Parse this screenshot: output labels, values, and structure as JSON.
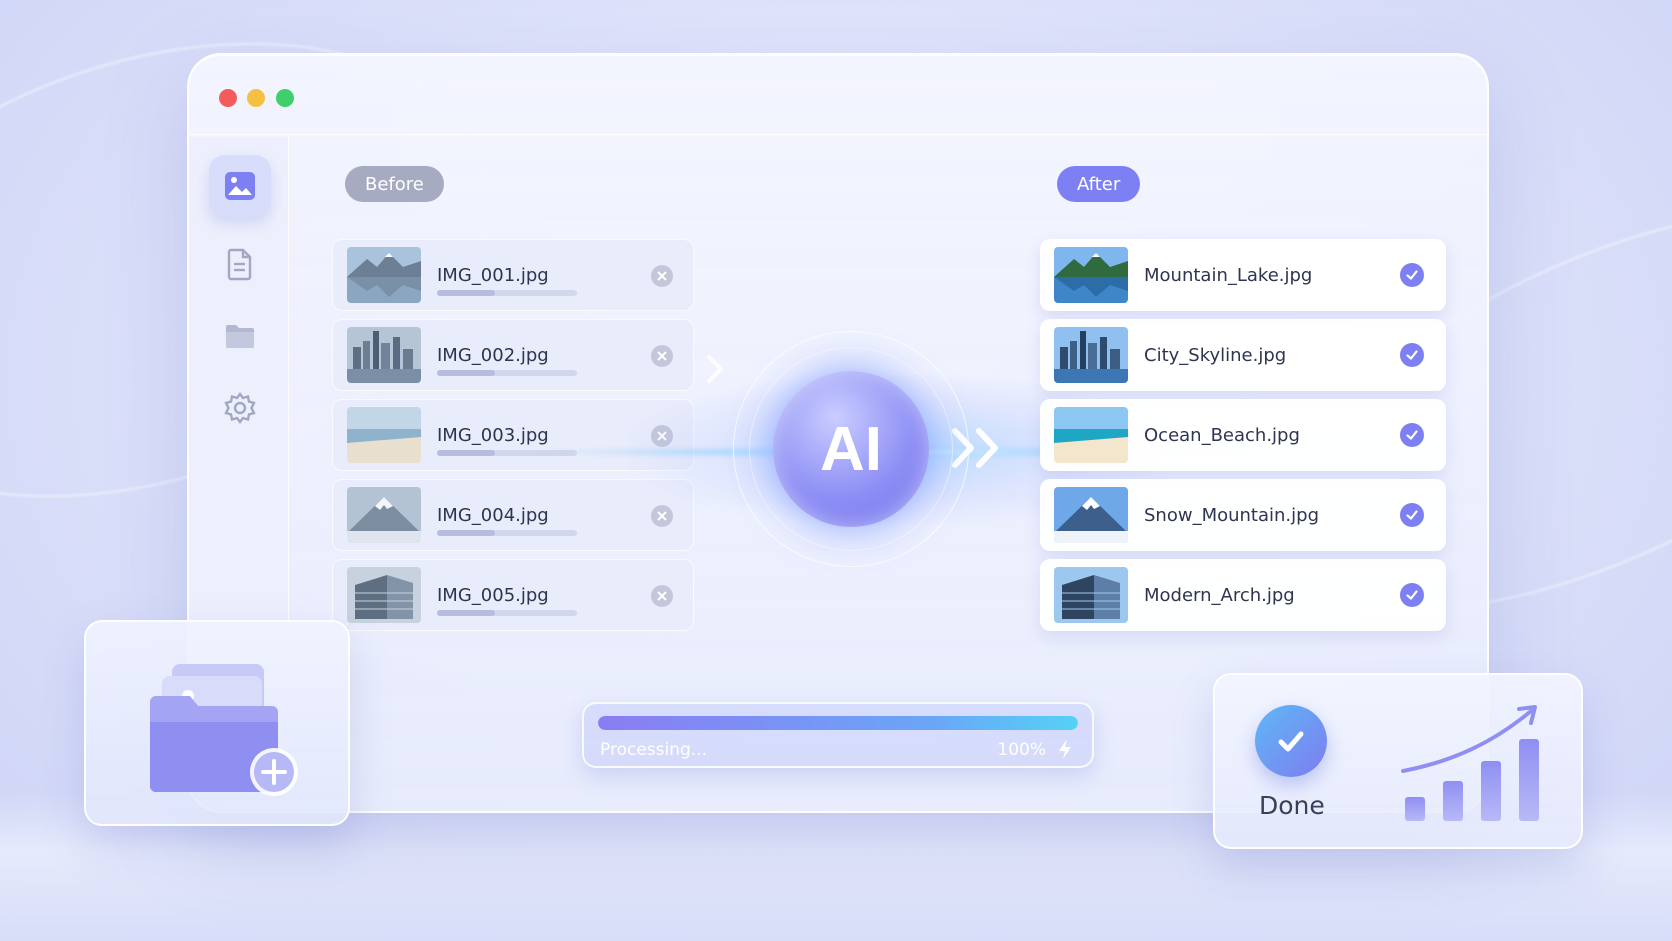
{
  "window": {
    "controls": [
      "close",
      "minimize",
      "maximize"
    ]
  },
  "sidebar": {
    "items": [
      {
        "icon": "image-icon",
        "active": true
      },
      {
        "icon": "document-icon",
        "active": false
      },
      {
        "icon": "folder-icon",
        "active": false
      },
      {
        "icon": "gear-icon",
        "active": false
      }
    ]
  },
  "before": {
    "label": "Before",
    "files": [
      {
        "name": "IMG_001.jpg",
        "thumb": "mountain-lake"
      },
      {
        "name": "IMG_002.jpg",
        "thumb": "city-skyline"
      },
      {
        "name": "IMG_003.jpg",
        "thumb": "ocean-beach"
      },
      {
        "name": "IMG_004.jpg",
        "thumb": "snow-mountain"
      },
      {
        "name": "IMG_005.jpg",
        "thumb": "modern-arch"
      }
    ]
  },
  "after": {
    "label": "After",
    "files": [
      {
        "name": "Mountain_Lake.jpg",
        "thumb": "mountain-lake"
      },
      {
        "name": "City_Skyline.jpg",
        "thumb": "city-skyline"
      },
      {
        "name": "Ocean_Beach.jpg",
        "thumb": "ocean-beach"
      },
      {
        "name": "Snow_Mountain.jpg",
        "thumb": "snow-mountain"
      },
      {
        "name": "Modern_Arch.jpg",
        "thumb": "modern-arch"
      }
    ]
  },
  "ai": {
    "label": "AI"
  },
  "progress": {
    "label": "Processing...",
    "percent_text": "100%",
    "value": 1.0
  },
  "done": {
    "label": "Done"
  },
  "colors": {
    "accent": "#7d80f2",
    "before_pill": "#a6abc2",
    "close": "#f25c5c",
    "minimize": "#f6c142",
    "maximize": "#3fcf6b"
  }
}
